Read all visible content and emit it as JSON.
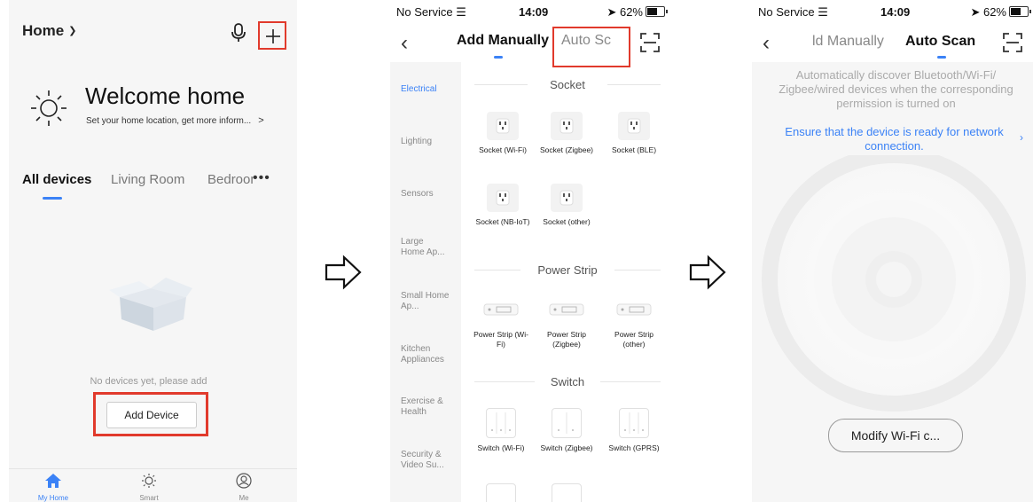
{
  "screen1": {
    "home_selector": "Home",
    "welcome_title": "Welcome home",
    "welcome_subtitle": "Set your home location, get more inform...",
    "tabs": [
      "All devices",
      "Living Room",
      "Bedroom"
    ],
    "empty_message": "No devices yet, please add",
    "add_device_label": "Add Device",
    "nav": [
      "My Home",
      "Smart",
      "Me"
    ],
    "colors": {
      "highlight": "#e13a2c",
      "accent": "#3b82f6"
    }
  },
  "screen2": {
    "status": {
      "carrier": "No Service",
      "time": "14:09",
      "battery": "62%"
    },
    "tab_manual": "Add Manually",
    "tab_auto_truncated": "Auto Sc",
    "categories": [
      "Electrical",
      "Lighting",
      "Sensors",
      "Large Home Ap...",
      "Small Home Ap...",
      "Kitchen Appliances",
      "Exercise & Health",
      "Security & Video Su..."
    ],
    "sections": {
      "socket": {
        "title": "Socket",
        "devices": [
          "Socket (Wi-Fi)",
          "Socket (Zigbee)",
          "Socket (BLE)",
          "Socket (NB-IoT)",
          "Socket (other)"
        ]
      },
      "power_strip": {
        "title": "Power Strip",
        "devices": [
          "Power Strip (Wi-Fi)",
          "Power Strip (Zigbee)",
          "Power Strip (other)"
        ]
      },
      "switch": {
        "title": "Switch",
        "devices": [
          "Switch (Wi-Fi)",
          "Switch (Zigbee)",
          "Switch (GPRS)"
        ]
      }
    }
  },
  "screen3": {
    "status": {
      "carrier": "No Service",
      "time": "14:09",
      "battery": "62%"
    },
    "tab_manual_truncated": "ld Manually",
    "tab_auto": "Auto Scan",
    "description": "Automatically discover Bluetooth/Wi-Fi/ Zigbee/wired devices when the corresponding permission is turned on",
    "link": "Ensure that the device is ready for network connection.",
    "wifi_button": "Modify Wi-Fi c..."
  }
}
